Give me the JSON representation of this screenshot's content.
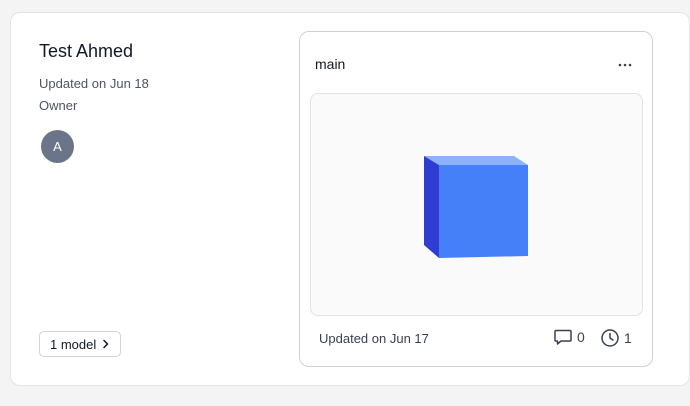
{
  "project": {
    "title": "Test Ahmed",
    "updated": "Updated on Jun 18",
    "role": "Owner",
    "avatar_initial": "A",
    "models_button_label": "1 model"
  },
  "model": {
    "name": "main",
    "updated": "Updated on Jun 17",
    "comments_count": "0",
    "versions_count": "1"
  },
  "icons": {
    "more": "more-horizontal-icon",
    "chevron": "chevron-right-icon",
    "comment": "comment-icon",
    "history": "clock-icon",
    "preview": "cube-icon"
  },
  "colors": {
    "avatar_bg": "#6b7589",
    "cube_front": "#4680f8",
    "cube_top": "#8db1fb",
    "cube_side": "#2f3ed0"
  }
}
